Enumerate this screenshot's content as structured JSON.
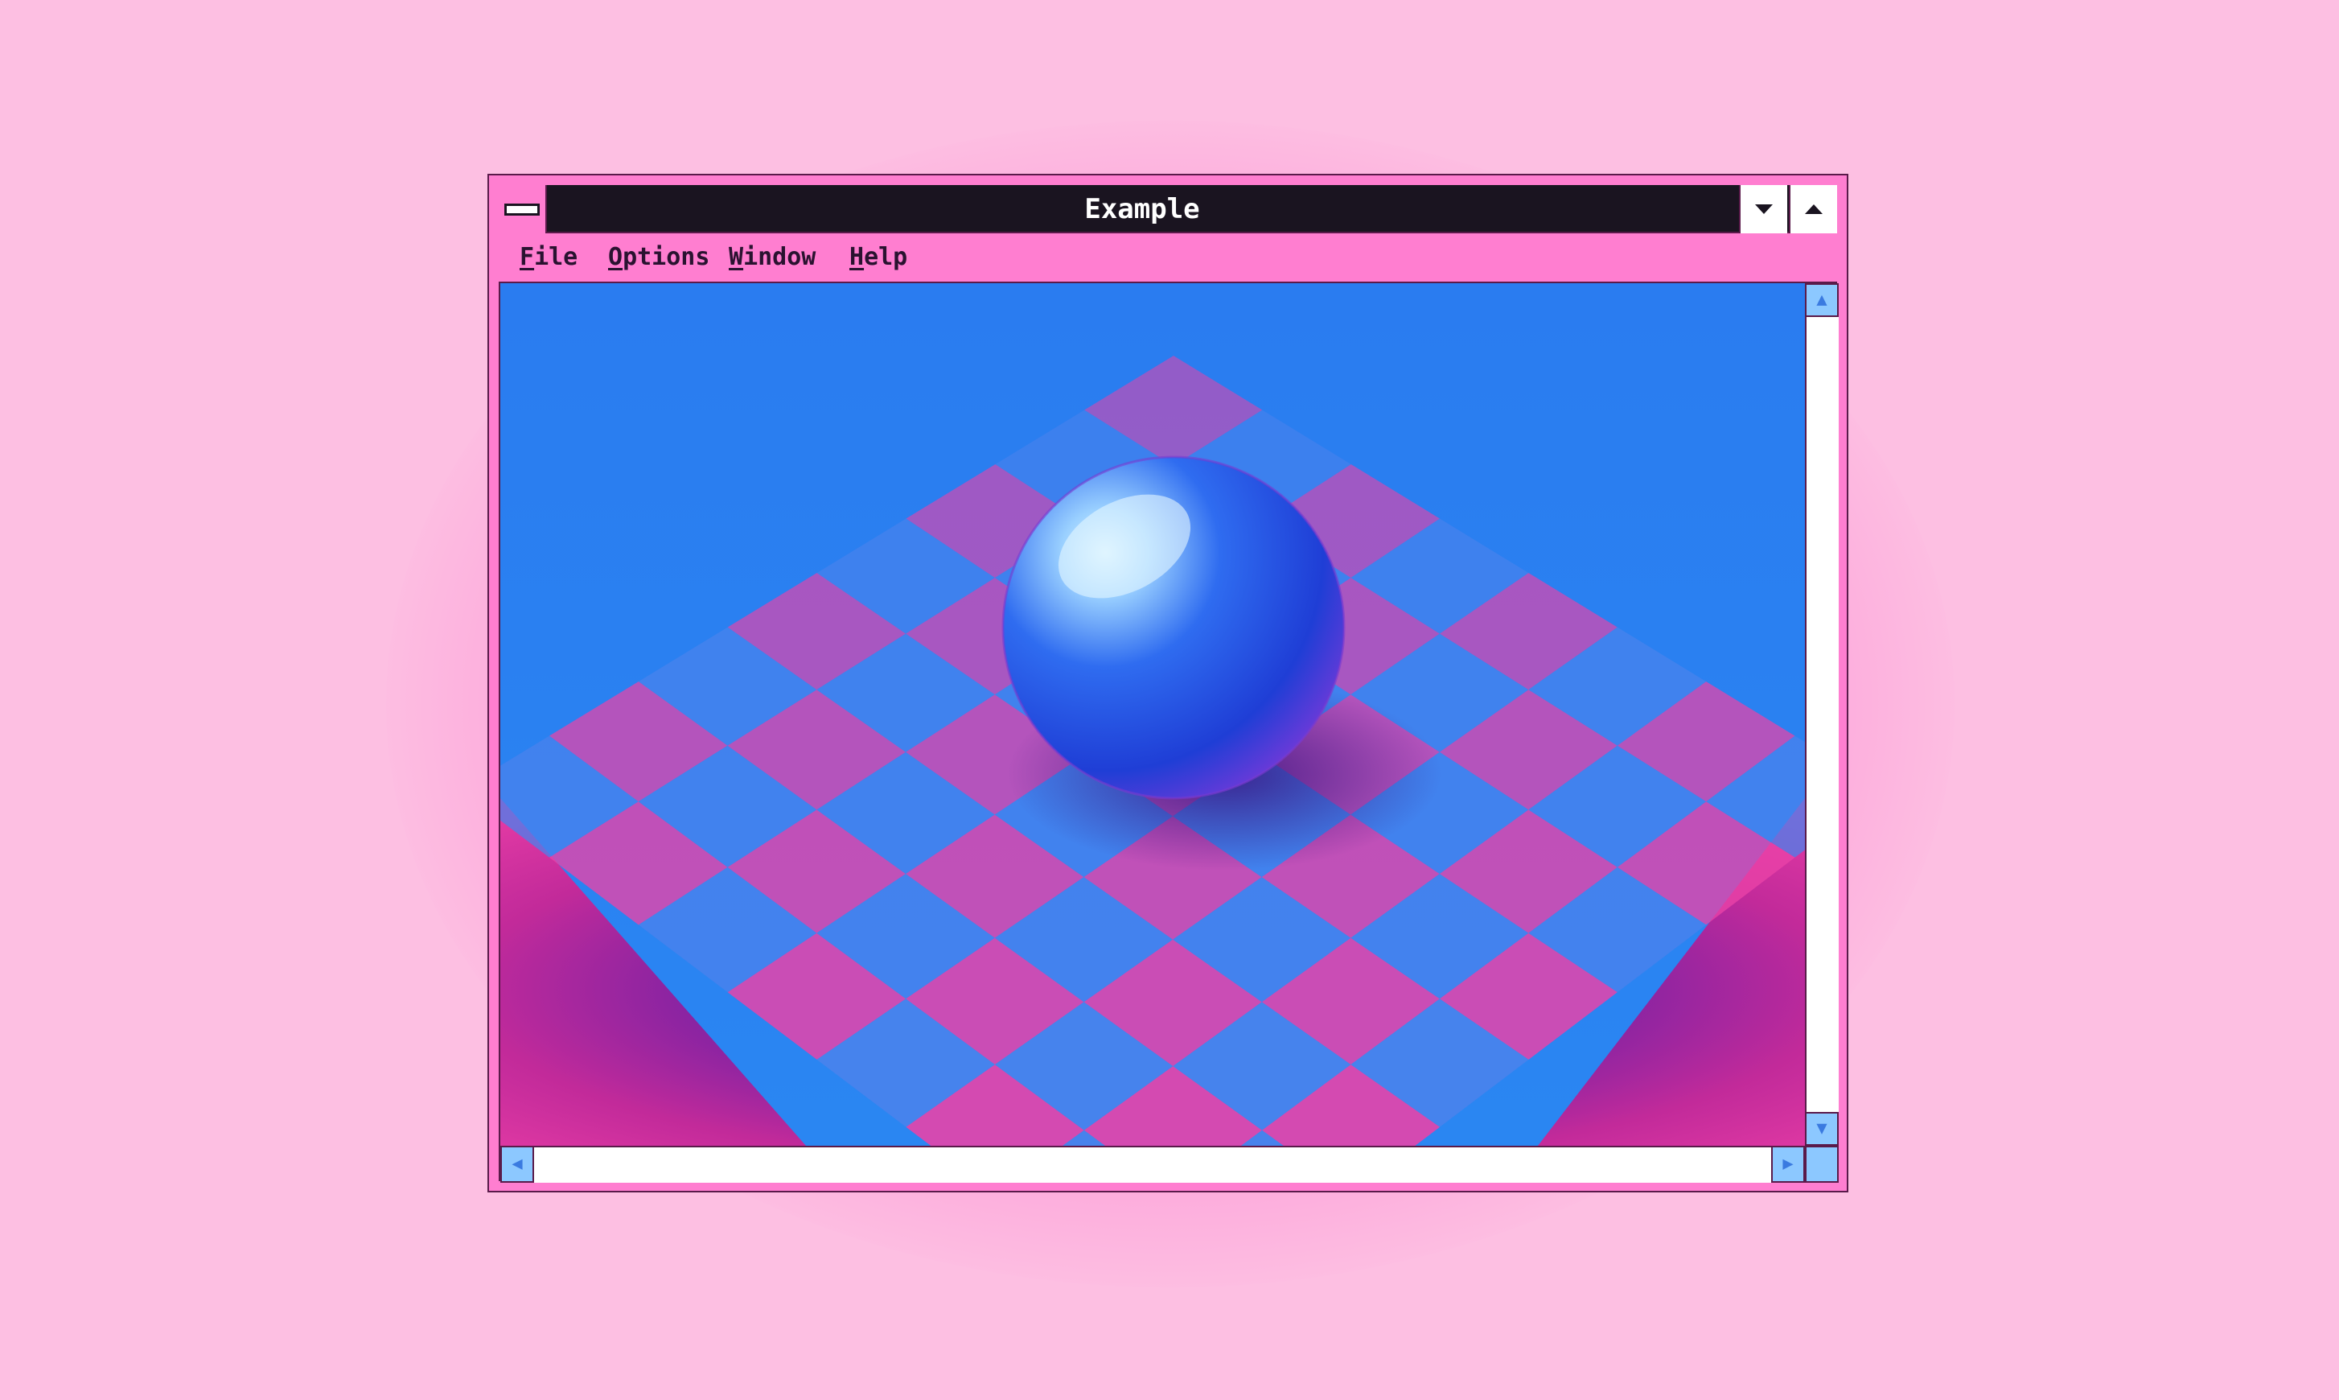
{
  "window": {
    "title": "Example",
    "menu": [
      {
        "accel": "F",
        "rest": "ile"
      },
      {
        "accel": "O",
        "rest": "ptions"
      },
      {
        "accel": "W",
        "rest": "indow"
      },
      {
        "accel": "H",
        "rest": "elp"
      }
    ]
  },
  "icons": {
    "system_menu": "system-menu-icon",
    "minimize": "triangle-down-icon",
    "maximize": "triangle-up-icon",
    "scroll_up": "arrow-up-icon",
    "scroll_down": "arrow-down-icon",
    "scroll_left": "arrow-left-icon",
    "scroll_right": "arrow-right-icon"
  },
  "colors": {
    "background": "#fdbfe2",
    "frame": "#ff7ed0",
    "titlebar": "#1a1420",
    "sky": "#2a7ef0",
    "tile_pink": "#ea42a8",
    "tile_blue": "#4a82ec",
    "sphere": "#2a5ee8"
  }
}
